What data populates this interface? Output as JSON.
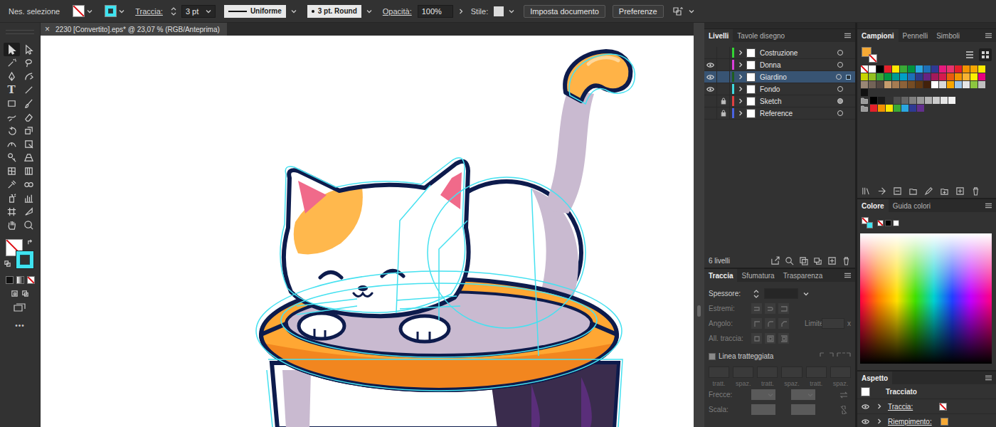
{
  "appearance": {
    "fill": "none",
    "stroke": "#3fe3f0"
  },
  "control_bar": {
    "selection": "Nes. selezione",
    "stroke_label": "Traccia:",
    "stroke_weight": "3 pt",
    "profile": "Uniforme",
    "brush": "3 pt. Round",
    "opacity_label": "Opacità:",
    "opacity": "100%",
    "style_label": "Stile:",
    "buttons": [
      "Imposta documento",
      "Preferenze"
    ]
  },
  "document": {
    "close": "×",
    "title": "2230 [Convertito].eps* @ 23,07 % (RGB/Anteprima)"
  },
  "toolbar": {
    "tools": [
      {
        "kind": "icon",
        "selected": true
      },
      {
        "kind": "icon",
        "selected": false
      },
      {
        "kind": "icon",
        "selected": false
      },
      {
        "kind": "icon",
        "selected": false
      },
      {
        "kind": "icon",
        "selected": false
      },
      {
        "kind": "icon",
        "selected": false
      },
      {
        "kind": "glyph",
        "glyph": "T",
        "selected": false
      },
      {
        "kind": "icon",
        "selected": false
      },
      {
        "kind": "icon",
        "selected": false
      },
      {
        "kind": "icon",
        "selected": false
      },
      {
        "kind": "icon",
        "selected": false
      },
      {
        "kind": "icon",
        "selected": false
      },
      {
        "kind": "icon",
        "selected": false
      },
      {
        "kind": "icon",
        "selected": false
      },
      {
        "kind": "icon",
        "selected": false
      },
      {
        "kind": "icon",
        "selected": false
      },
      {
        "kind": "icon",
        "selected": false
      },
      {
        "kind": "icon",
        "selected": false
      },
      {
        "kind": "icon",
        "selected": false
      },
      {
        "kind": "icon",
        "selected": false
      },
      {
        "kind": "icon",
        "selected": false
      },
      {
        "kind": "icon",
        "selected": false
      },
      {
        "kind": "icon",
        "selected": false
      },
      {
        "kind": "icon",
        "selected": false
      },
      {
        "kind": "icon",
        "selected": false
      },
      {
        "kind": "icon",
        "selected": false
      },
      {
        "kind": "icon",
        "selected": false
      },
      {
        "kind": "icon",
        "selected": false
      }
    ],
    "more": "•••"
  },
  "layers_panel": {
    "tabs": [
      {
        "label": "Livelli",
        "selected": true
      },
      {
        "label": "Tavole disegno",
        "selected": false
      }
    ],
    "layers": [
      {
        "name": "Costruzione",
        "visible": false,
        "locked": false,
        "selected": false,
        "targeted": false,
        "color": "#34d434"
      },
      {
        "name": "Donna",
        "visible": true,
        "locked": false,
        "selected": false,
        "targeted": false,
        "color": "#d93fd9"
      },
      {
        "name": "Giardino",
        "visible": true,
        "locked": false,
        "selected": true,
        "targeted": false,
        "color": "#1e5e1e"
      },
      {
        "name": "Fondo",
        "visible": true,
        "locked": false,
        "selected": false,
        "targeted": false,
        "color": "#3fd9e0"
      },
      {
        "name": "Sketch",
        "visible": false,
        "locked": true,
        "selected": false,
        "targeted": true,
        "color": "#e04040"
      },
      {
        "name": "Reference",
        "visible": false,
        "locked": true,
        "selected": false,
        "targeted": false,
        "color": "#4a63e0"
      }
    ],
    "count": "6 livelli"
  },
  "stroke_panel": {
    "tabs": [
      {
        "label": "Traccia",
        "selected": true
      },
      {
        "label": "Sfumatura",
        "selected": false
      },
      {
        "label": "Trasparenza",
        "selected": false
      }
    ],
    "weight_label": "Spessore:",
    "caps_label": "Estremi:",
    "corner_label": "Angolo:",
    "limit_label": "Limite:",
    "limit_unit": "x",
    "align_label": "All. traccia:",
    "dashed": {
      "label": "Linea tratteggiata",
      "checked": false
    },
    "dash_fields": [
      "tratt.",
      "spaz.",
      "tratt.",
      "spaz.",
      "tratt.",
      "spaz."
    ],
    "arrows_label": "Frecce:",
    "scale_label": "Scala:"
  },
  "swatches_panel": {
    "tabs": [
      {
        "label": "Campioni",
        "selected": true
      },
      {
        "label": "Pennelli",
        "selected": false
      },
      {
        "label": "Simboli",
        "selected": false
      }
    ],
    "view_modes": [
      {
        "kind": "list",
        "selected": false
      },
      {
        "kind": "grid",
        "selected": true
      }
    ],
    "current": {
      "fill": "#f6a935",
      "stroke": "none"
    },
    "rows": [
      [
        "none",
        "#ffffff",
        "#000000",
        "#e4202a",
        "#ffe600",
        "#3aaa35",
        "#00923f",
        "#2aa7e0",
        "#1d70b7",
        "#2e3a93",
        "#e5197d",
        "#e8336e",
        "#e5202a",
        "#f39200",
        "#f7a600",
        "#fdeb00"
      ],
      [
        "#c8d400",
        "#93c01f",
        "#3ba935",
        "#00963f",
        "#009a93",
        "#00a0c6",
        "#1d70b7",
        "#2b3a8c",
        "#662482",
        "#a3195b",
        "#d51a4e",
        "#ea5b0c",
        "#f39200",
        "#f9b233",
        "#ffed00",
        "#e6007e"
      ],
      [
        "#998675",
        "#736357",
        "#534741",
        "#c69c6d",
        "#a67c52",
        "#8c6239",
        "#754c24",
        "#603813",
        "#42210b",
        "#ffffff",
        "#d9d9d9",
        "#f7a600",
        "#9bc4e8",
        "#e6e6e6",
        "#8cc63f",
        "#c0c0c0"
      ],
      [
        "#111111"
      ]
    ],
    "groups": [
      [
        "#000000",
        "#1a1a1a",
        "#333333",
        "#4d4d4d",
        "#666666",
        "#808080",
        "#999999",
        "#b3b3b3",
        "#cccccc",
        "#e6e6e6",
        "#f2f2f2"
      ],
      [
        "#e4202a",
        "#f39200",
        "#ffe600",
        "#3aaa35",
        "#2aa7e0",
        "#2e3a93",
        "#632f8e"
      ]
    ]
  },
  "color_panel": {
    "tabs": [
      {
        "label": "Colore",
        "selected": true
      },
      {
        "label": "Guida colori",
        "selected": false
      }
    ],
    "quick": [
      "none",
      "#000000",
      "#ffffff"
    ]
  },
  "appearance_panel": {
    "tabs": [
      {
        "label": "Aspetto",
        "selected": true
      }
    ],
    "object": "Tracciato",
    "attributes": [
      {
        "label": "Traccia:",
        "color": "none",
        "visible": true
      },
      {
        "label": "Riempimento:",
        "color": "#f6a935",
        "visible": true
      }
    ]
  }
}
